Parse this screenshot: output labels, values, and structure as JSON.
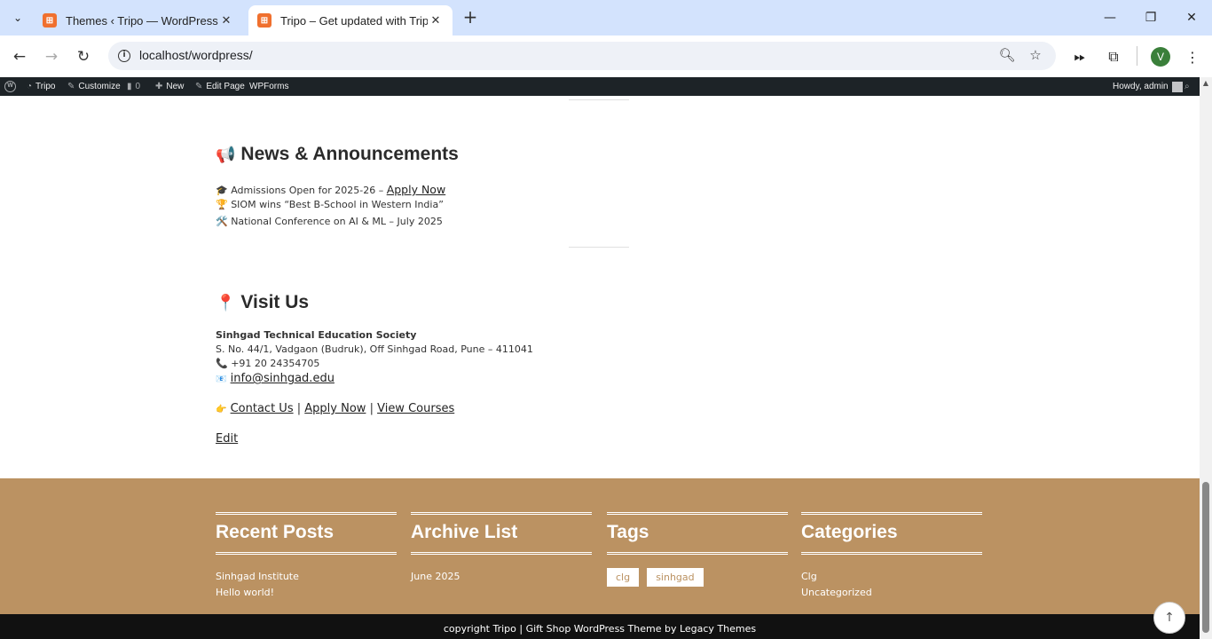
{
  "browser": {
    "tabs": [
      {
        "title": "Themes ‹ Tripo — WordPress",
        "active": false
      },
      {
        "title": "Tripo – Get updated with Tripo",
        "active": true
      }
    ],
    "url": "localhost/wordpress/",
    "profile_initial": "V"
  },
  "adminbar": {
    "site": "Tripo",
    "customize": "Customize",
    "comments": "0",
    "new": "New",
    "edit_page": "Edit Page",
    "wpforms": "WPForms",
    "howdy": "Howdy, admin"
  },
  "news": {
    "icon": "📢",
    "title": "News & Announcements",
    "items": [
      {
        "icon": "🎓",
        "text": "Admissions Open for 2025-26 – ",
        "link": "Apply Now"
      },
      {
        "icon": "🏆",
        "text": "SIOM wins “Best B-School in Western India”",
        "link": ""
      },
      {
        "icon": "🛠️",
        "text": "National Conference on AI & ML – July 2025",
        "link": ""
      }
    ]
  },
  "visit": {
    "icon": "📍",
    "title": "Visit Us",
    "org": "Sinhgad Technical Education Society",
    "address": "S. No. 44/1, Vadgaon (Budruk), Off Sinhgad Road, Pune – 411041",
    "phone_icon": "📞",
    "phone": "+91 20 24354705",
    "email_icon": "📧",
    "email": "info@sinhgad.edu",
    "hand_icon": "👉",
    "links": [
      "Contact Us",
      "Apply Now",
      "View Courses"
    ],
    "separator": "|",
    "edit": "Edit"
  },
  "footer": {
    "recent_posts": {
      "title": "Recent Posts",
      "items": [
        "Sinhgad Institute",
        "Hello world!"
      ]
    },
    "archive": {
      "title": "Archive List",
      "items": [
        "June 2025"
      ]
    },
    "tags": {
      "title": "Tags",
      "items": [
        "clg",
        "sinhgad"
      ]
    },
    "categories": {
      "title": "Categories",
      "items": [
        "Clg",
        "Uncategorized"
      ]
    },
    "copyright": "copyright Tripo | Gift Shop WordPress Theme by Legacy Themes"
  },
  "colors": {
    "footer_bg": "#bb9262",
    "adminbar_bg": "#1d2327",
    "tabstrip_bg": "#d3e3fd"
  }
}
